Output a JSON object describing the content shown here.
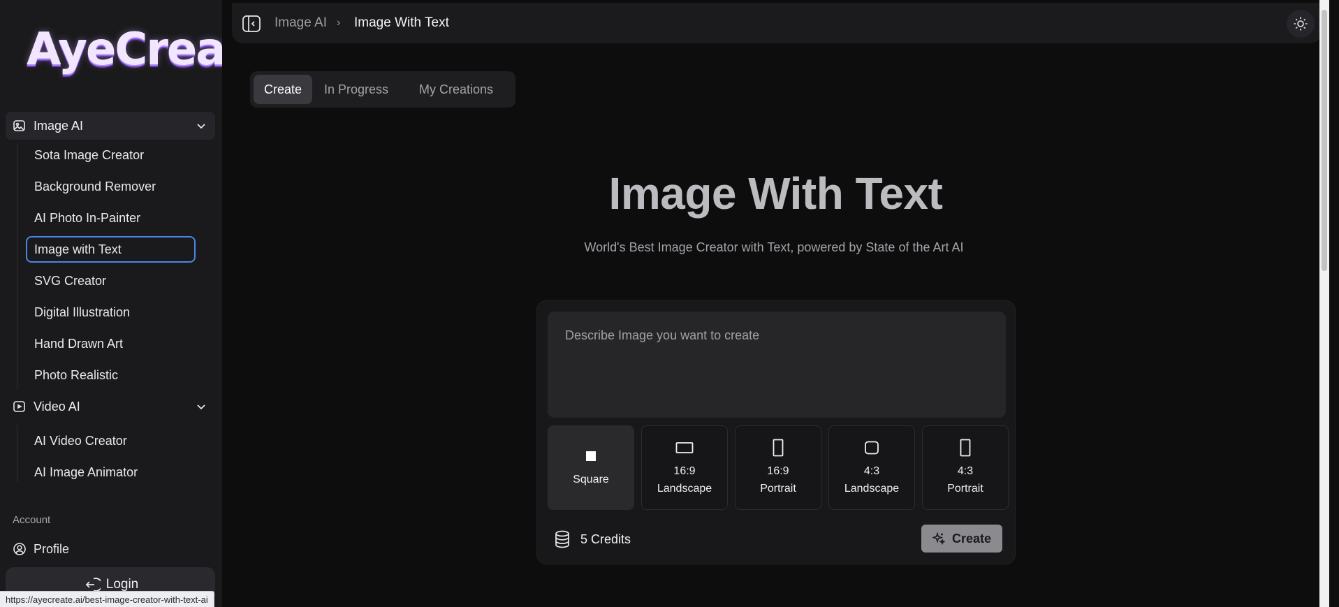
{
  "app": {
    "logo_text": "AyeCreate"
  },
  "sidebar": {
    "groups": [
      {
        "label": "Image AI",
        "icon": "image-ai-icon",
        "items": [
          {
            "label": "Sota Image Creator"
          },
          {
            "label": "Background Remover"
          },
          {
            "label": "AI Photo In-Painter"
          },
          {
            "label": "Image with Text",
            "active": true
          },
          {
            "label": "SVG Creator"
          },
          {
            "label": "Digital Illustration"
          },
          {
            "label": "Hand Drawn Art"
          },
          {
            "label": "Photo Realistic"
          }
        ]
      },
      {
        "label": "Video AI",
        "icon": "video-ai-icon",
        "items": [
          {
            "label": "AI Video Creator"
          },
          {
            "label": "AI Image Animator"
          }
        ]
      }
    ],
    "account_label": "Account",
    "profile_label": "Profile",
    "login_label": "Login"
  },
  "status_bar": {
    "url": "https://ayecreate.ai/best-image-creator-with-text-ai"
  },
  "breadcrumb": {
    "parent": "Image AI",
    "separator": "›",
    "current": "Image With Text"
  },
  "tabs": [
    {
      "label": "Create",
      "active": true
    },
    {
      "label": "In Progress"
    },
    {
      "label": "My Creations"
    }
  ],
  "hero": {
    "title": "Image With Text",
    "subtitle": "World's Best Image Creator with Text, powered by State of the Art AI"
  },
  "form": {
    "prompt_placeholder": "Describe Image you want to create",
    "prompt_value": "",
    "aspect_ratios": [
      {
        "ratio": "",
        "label": "Square",
        "selected": true
      },
      {
        "ratio": "16:9",
        "label": "Landscape"
      },
      {
        "ratio": "16:9",
        "label": "Portrait"
      },
      {
        "ratio": "4:3",
        "label": "Landscape"
      },
      {
        "ratio": "4:3",
        "label": "Portrait"
      }
    ],
    "credits": "5 Credits",
    "create_label": "Create"
  },
  "colors": {
    "sidebar_bg": "#1a1a1c",
    "main_bg": "#0d0d0e",
    "active_outline": "#4a86e8",
    "create_button": "#8b8b8f"
  }
}
